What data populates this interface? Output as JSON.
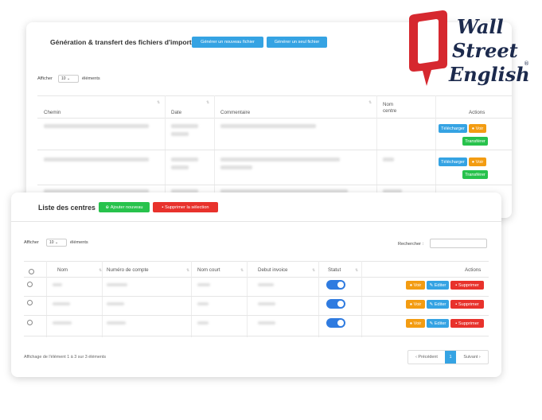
{
  "back_panel": {
    "title": "Génération & transfert des fichiers d'import",
    "btn_generate_new": "Générer un nouveau fichier",
    "btn_generate_single": "Générer un seul fichier",
    "show_prefix": "Afficher",
    "show_value": "10",
    "show_suffix": "éléments",
    "columns": [
      "Chemin",
      "Date",
      "Commentaire",
      "Nom centre",
      "Actions"
    ],
    "row_actions": {
      "download": "Télécharger",
      "view": "Voir",
      "transfer": "Transférer"
    }
  },
  "front_panel": {
    "title": "Liste des centres",
    "btn_add": "Ajouter nouveau",
    "btn_delete_selection": "Supprimer la sélection",
    "show_prefix": "Afficher",
    "show_value": "10",
    "show_suffix": "éléments",
    "search_label": "Rechercher :",
    "columns": [
      "Nom",
      "Numéro de compte",
      "Nom court",
      "Debut invoice",
      "Statut",
      "Actions"
    ],
    "row_actions": {
      "view": "Voir",
      "edit": "Editer",
      "delete": "Supprimer"
    },
    "footer_info": "Affichage de l'élément 1 à 3 sur 3 éléments",
    "pagination": {
      "prev": "‹ Précédent",
      "page": "1",
      "next": "Suivant ›"
    }
  },
  "logo": {
    "line1": "Wall",
    "line2": "Street",
    "line3": "English",
    "mark": "®",
    "brand_red": "#d6282f",
    "brand_navy": "#1c2a4d"
  },
  "colors": {
    "blue": "#35a3e3",
    "orange": "#f39c12",
    "green": "#27c24c",
    "red": "#e8322c",
    "toggle": "#2f7be0"
  }
}
